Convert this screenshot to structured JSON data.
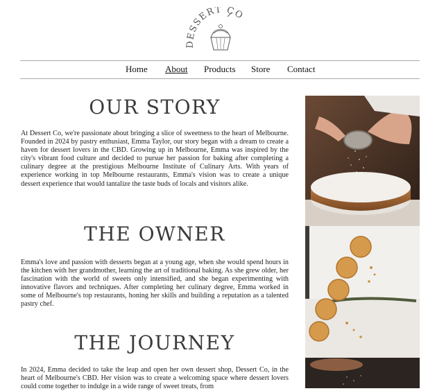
{
  "logo": {
    "text": "DESSERT CO"
  },
  "nav": {
    "items": [
      {
        "label": "Home",
        "active": false
      },
      {
        "label": "About",
        "active": true
      },
      {
        "label": "Products",
        "active": false
      },
      {
        "label": "Store",
        "active": false
      },
      {
        "label": "Contact",
        "active": false
      }
    ]
  },
  "sections": [
    {
      "heading": "OUR STORY",
      "body": "At Dessert Co, we're passionate about bringing a slice of sweetness to the heart of Melbourne. Founded in 2024 by pastry enthusiast, Emma Taylor, our story began with a dream to create a haven for dessert lovers in the CBD. Growing up in Melbourne, Emma was inspired by the city's vibrant food culture and decided to pursue her passion for baking after completing a culinary degree at the prestigious Melbourne Institute of Culinary Arts. With years of experience working in top Melbourne restaurants, Emma's vision was to create a unique dessert experience that would tantalize the taste buds of locals and visitors alike."
    },
    {
      "heading": "THE OWNER",
      "body": "Emma's love and passion with desserts began at a young age, when she would spend hours in the kitchen with her grandmother, learning the art of traditional baking. As she grew older, her fascination with the world of sweets only intensified, and she began experimenting with innovative flavors and techniques. After completing her culinary degree, Emma worked in some of Melbourne's top restaurants, honing her skills and building a reputation as a talented pastry chef."
    },
    {
      "heading": "THE JOURNEY",
      "body": "In 2024, Emma decided to take the leap and open her own dessert shop, Dessert Co, in the heart of Melbourne's CBD. Her vision was to create a welcoming space where dessert lovers could come together to indulge in a wide range of sweet treats, from"
    }
  ],
  "images": [
    {
      "name": "dusting-cake-photo"
    },
    {
      "name": "citrus-cake-photo"
    },
    {
      "name": "sieve-photo"
    }
  ]
}
